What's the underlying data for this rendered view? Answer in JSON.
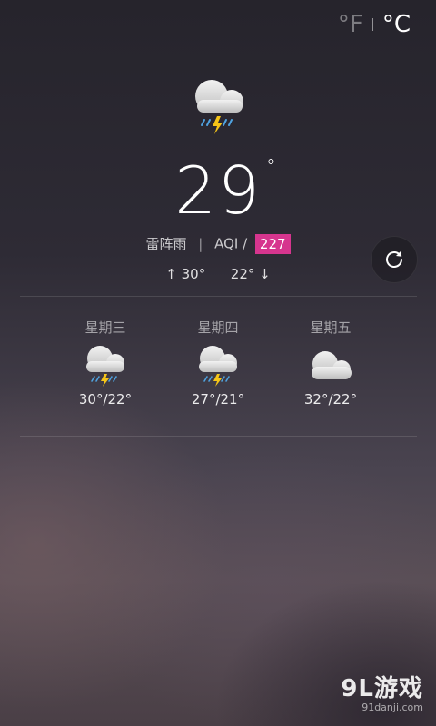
{
  "units": {
    "fahrenheit": "°F",
    "celsius": "°C",
    "selected": "°C"
  },
  "current": {
    "icon": "thunderstorm-icon",
    "temperature": "29",
    "degree_symbol": "°",
    "condition": "雷阵雨",
    "separator": "|",
    "aqi_label": "AQI /",
    "aqi_value": "227",
    "aqi_color": "#d6358e",
    "high": "↑ 30°",
    "low": "22° ↓"
  },
  "forecast": [
    {
      "day": "星期三",
      "icon": "thunderstorm-icon",
      "range": "30°/22°"
    },
    {
      "day": "星期四",
      "icon": "thunderstorm-icon",
      "range": "27°/21°"
    },
    {
      "day": "星期五",
      "icon": "cloudy-icon",
      "range": "32°/22°"
    }
  ],
  "watermark": {
    "main": "9L游戏",
    "sub": "91danji.com"
  }
}
